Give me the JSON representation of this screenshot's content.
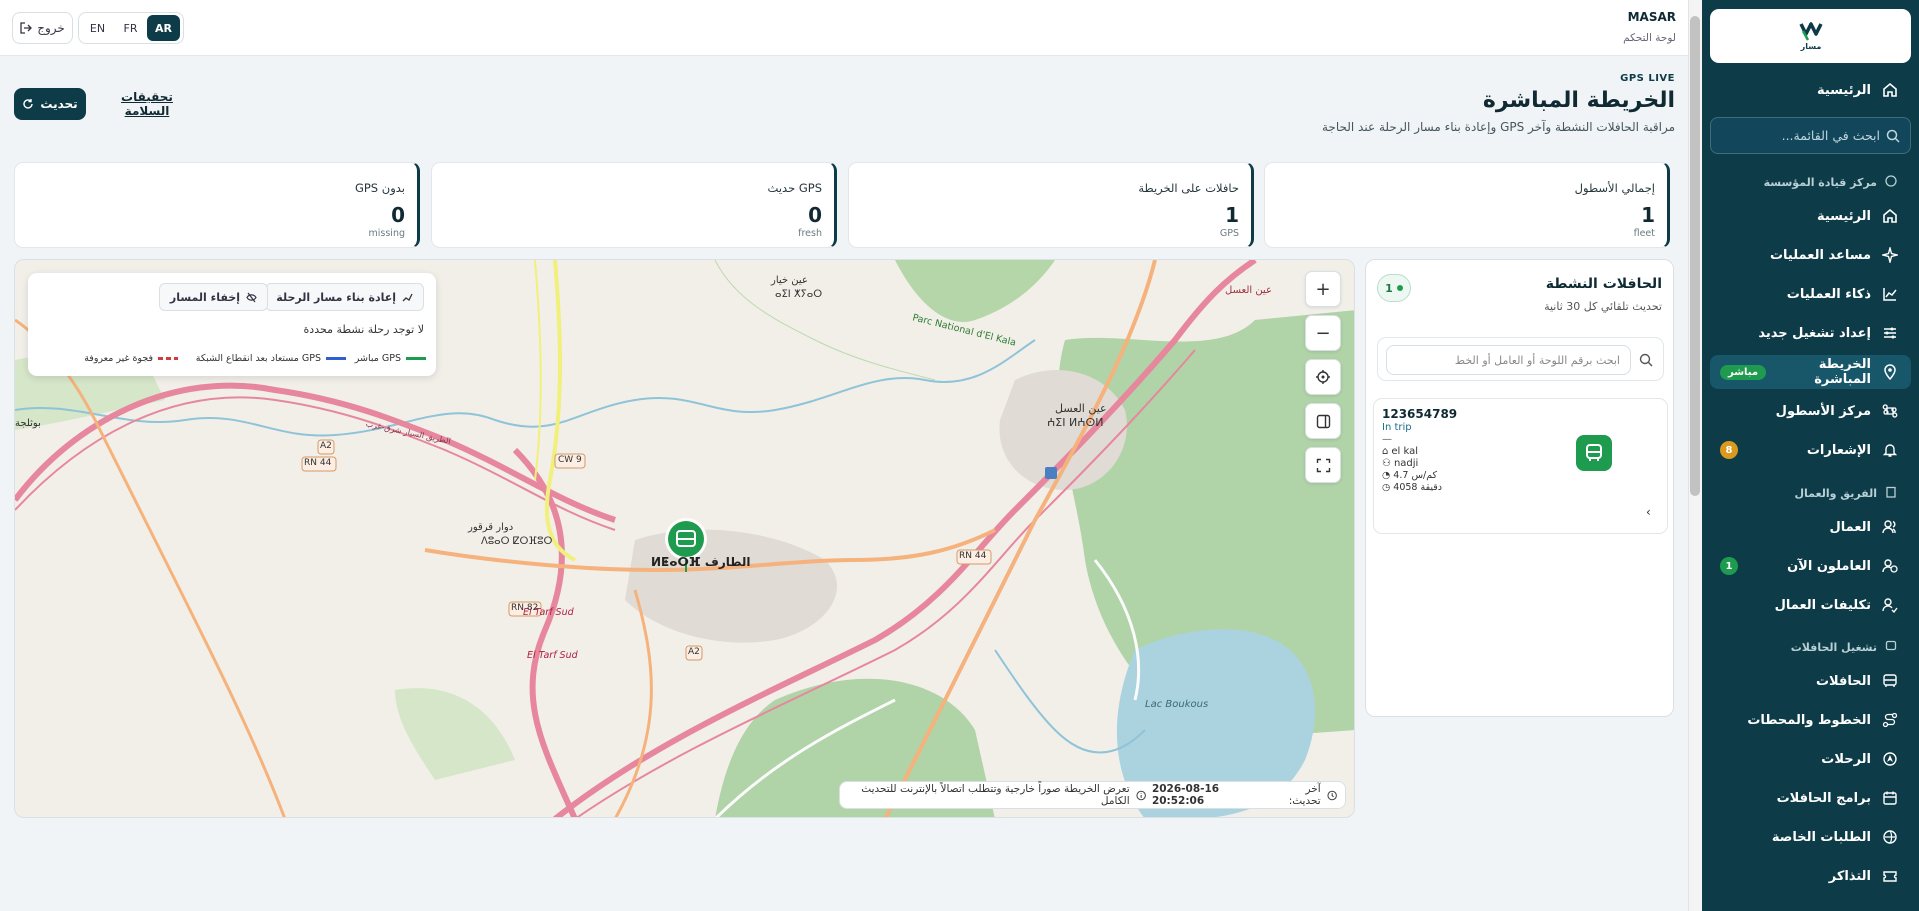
{
  "app": {
    "name": "MASAR",
    "subtitle": "لوحة التحكم"
  },
  "header": {
    "languages": [
      {
        "label": "AR",
        "active": true
      },
      {
        "label": "FR",
        "active": false
      },
      {
        "label": "EN",
        "active": false
      }
    ],
    "logout_label": "خروج"
  },
  "sidebar": {
    "brand_text": "مسار",
    "top_item": {
      "label": "الرئيسية",
      "icon": "home-icon"
    },
    "search_placeholder": "ابحث في القائمة...",
    "sections": [
      {
        "title": "مركز قيادة المؤسسة",
        "icon": "compass-icon",
        "items": [
          {
            "label": "الرئيسية",
            "icon": "home-icon"
          },
          {
            "label": "مساعد العمليات",
            "icon": "sparkle-icon"
          },
          {
            "label": "ذكاء العمليات",
            "icon": "chart-icon"
          },
          {
            "label": "إعداد تشغيل جديد",
            "icon": "sliders-icon"
          },
          {
            "label": "الخريطة المباشرة",
            "icon": "map-pin-icon",
            "badge": "مباشر",
            "active": true
          },
          {
            "label": "مركز الأسطول",
            "icon": "command-icon"
          },
          {
            "label": "الإشعارات",
            "icon": "bell-icon",
            "count": "8"
          }
        ]
      },
      {
        "title": "الفريق والعمال",
        "icon": "building-icon",
        "items": [
          {
            "label": "العمال",
            "icon": "users-icon"
          },
          {
            "label": "العاملون الآن",
            "icon": "user-clock-icon",
            "count": "1"
          },
          {
            "label": "تكليفات العمال",
            "icon": "user-check-icon"
          }
        ]
      },
      {
        "title": "تشغيل الحافلات",
        "icon": "bus-icon",
        "items": [
          {
            "label": "الحافلات",
            "icon": "bus-icon"
          },
          {
            "label": "الخطوط والمحطات",
            "icon": "route-icon"
          },
          {
            "label": "الرحلات",
            "icon": "navigation-icon"
          },
          {
            "label": "برامج الحافلات",
            "icon": "calendar-icon"
          },
          {
            "label": "الطلبات الخاصة",
            "icon": "package-icon"
          },
          {
            "label": "التذاكر",
            "icon": "ticket-icon"
          }
        ]
      }
    ]
  },
  "page": {
    "kicker": "GPS LIVE",
    "title": "الخريطة المباشرة",
    "description": "مراقبة الحافلات النشطة وآخر GPS وإعادة بناء مسار الرحلة عند الحاجة",
    "refresh_label": "تحديث",
    "safety_link": "تحقيقات السلامة"
  },
  "stats": [
    {
      "title": "إجمالي الأسطول",
      "value": "1",
      "sub": "fleet"
    },
    {
      "title": "حافلات على الخريطة",
      "value": "1",
      "sub": "GPS"
    },
    {
      "title": "GPS حديث",
      "value": "0",
      "sub": "fresh"
    },
    {
      "title": "بدون GPS",
      "value": "0",
      "sub": "missing"
    }
  ],
  "map": {
    "rebuild_label": "إعادة بناء مسار الرحلة",
    "hide_label": "إخفاء المسار",
    "no_trip_note": "لا توجد رحلة نشطة محددة",
    "legend": [
      {
        "label": "GPS مباشر",
        "color": "#1f9b4f",
        "dashed": false
      },
      {
        "label": "GPS مستعاد بعد انقطاع الشبكة",
        "color": "#2f5fd0",
        "dashed": false
      },
      {
        "label": "فجوة غير معروفة",
        "color": "#d63b3b",
        "dashed": true
      }
    ],
    "status_last_update_label": "آخر تحديث:",
    "status_time": "2026-08-16 20:52:06",
    "status_note": "تعرض الخريطة صوراً خارجية وتتطلب اتصالاً بالإنترنت للتحديث الكامل",
    "controls": [
      "zoom-in",
      "zoom-out",
      "locate",
      "panel",
      "fullscreen"
    ],
    "labels": {
      "town_main": "الطارف ⵍⵟⴰⵔⴼ",
      "town_east_ar": "عين العسل",
      "town_east_tf": "ⵄⵉⵏ ⵍⵄⵙⵍ",
      "village_north_ar": "عين خيار",
      "village_north_tf": "ⴰⵉⵏ ⵅⵢⴰⵔ",
      "village_west_tf": "ⴷⵓⴰⵔ ⵇⵔⴼⵓⵔ",
      "village_west_ar": "دوار قرقور",
      "west_edge": "بوثلجة",
      "park": "Parc National d'El Kala",
      "lake": "Lac Boukous",
      "roads": [
        "CW 9",
        "A2",
        "RN 44",
        "RN 82",
        "A2",
        "RN 44"
      ],
      "el_tarf_sud_1": "El Tarf Sud",
      "el_tarf_sud_2": "El Tarf Sud",
      "highway": "الطريق السيار شرق-غرب",
      "northeast": "عين العسل"
    }
  },
  "active_panel": {
    "title": "الحافلات النشطة",
    "subtitle": "تحديث تلقائي كل 30 ثانية",
    "count": "1",
    "search_placeholder": "ابحث برقم اللوحة أو العامل أو الخط",
    "bus": {
      "plate": "123654789",
      "status": "In trip",
      "dash": "—",
      "line": "el kal",
      "worker": "nadji",
      "speed": "4.7 كم/س",
      "eta": "4058 دقيقة"
    }
  },
  "colors": {
    "primary": "#0d3b48",
    "live_green": "#1f9b4f",
    "badge_orange": "#d99a1e"
  }
}
